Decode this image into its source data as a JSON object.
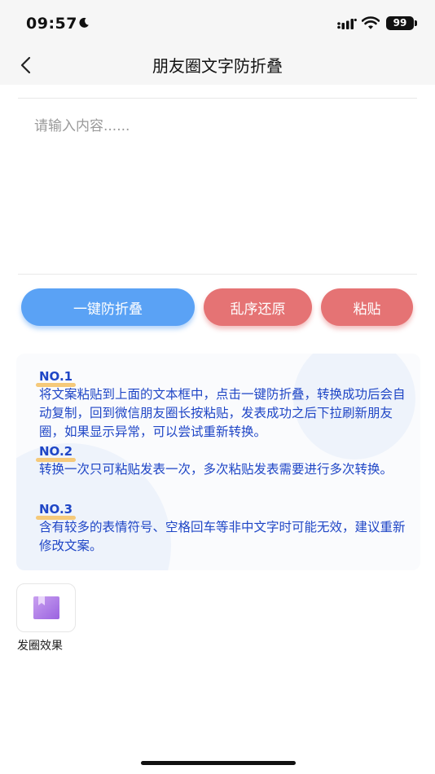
{
  "status_bar": {
    "time": "09:57",
    "battery": "99"
  },
  "nav": {
    "title": "朋友圈文字防折叠"
  },
  "input": {
    "placeholder": "请输入内容......"
  },
  "buttons": {
    "fold_proof": "一键防折叠",
    "restore": "乱序还原",
    "paste": "粘贴"
  },
  "tips": [
    {
      "label": "NO.1",
      "text": "将文案粘贴到上面的文本框中，点击一键防折叠，转换成功后会自动复制，回到微信朋友圈长按粘贴，发表成功之后下拉刷新朋友圈，如果显示异常，可以尝试重新转换。"
    },
    {
      "label": "NO.2",
      "text": "转换一次只可粘贴发表一次，多次粘贴发表需要进行多次转换。"
    },
    {
      "label": "NO.3",
      "text": "含有较多的表情符号、空格回车等非中文字时可能无效，建议重新修改文案。"
    }
  ],
  "effect": {
    "label": "发圈效果"
  },
  "colors": {
    "primary_button": "#5aa2f5",
    "secondary_button": "#e57374",
    "tip_text": "#1f46c6",
    "tip_underline": "#f5c97a"
  }
}
